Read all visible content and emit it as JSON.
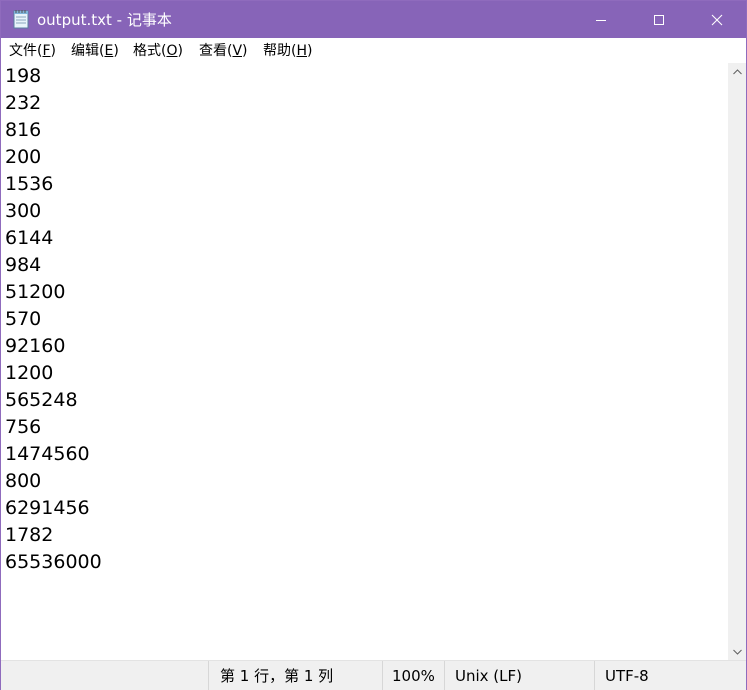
{
  "window": {
    "title": "output.txt - 记事本",
    "icon": "notepad-icon",
    "controls": [
      "minimize-icon",
      "maximize-icon",
      "close-icon"
    ]
  },
  "menu": {
    "file": {
      "prefix": "文件(",
      "key": "F",
      "suffix": ")"
    },
    "edit": {
      "prefix": "编辑(",
      "key": "E",
      "suffix": ")"
    },
    "format": {
      "prefix": "格式(",
      "key": "O",
      "suffix": ")"
    },
    "view": {
      "prefix": "查看(",
      "key": "V",
      "suffix": ")"
    },
    "help": {
      "prefix": "帮助(",
      "key": "H",
      "suffix": ")"
    }
  },
  "document": {
    "lines": [
      "198",
      "232",
      "816",
      "200",
      "1536",
      "300",
      "6144",
      "984",
      "51200",
      "570",
      "92160",
      "1200",
      "565248",
      "756",
      "1474560",
      "800",
      "6291456",
      "1782",
      "65536000"
    ]
  },
  "status": {
    "position": "第 1 行，第 1 列",
    "zoom": "100%",
    "line_ending": "Unix (LF)",
    "encoding": "UTF-8"
  },
  "colors": {
    "titlebar": "#8764b8",
    "statusbar": "#f0f0f0"
  }
}
